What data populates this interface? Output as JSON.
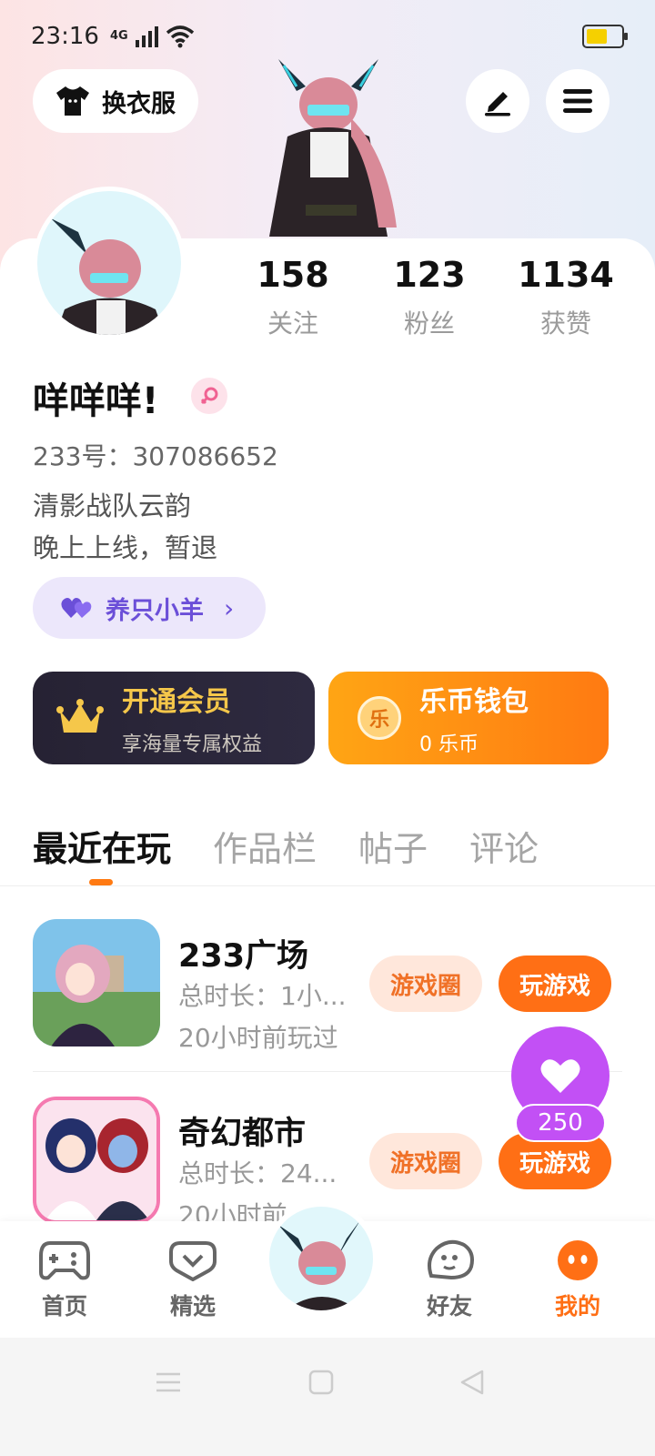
{
  "status_bar": {
    "time": "23:16",
    "network": "4G"
  },
  "header": {
    "dress_button_label": "换衣服"
  },
  "profile": {
    "stats": [
      {
        "value": "158",
        "label": "关注"
      },
      {
        "value": "123",
        "label": "粉丝"
      },
      {
        "value": "1134",
        "label": "获赞"
      }
    ],
    "username": "咩咩咩!",
    "uid": "233号：307086652",
    "bio_line1": "清影战队云韵",
    "bio_line2": "晚上上线，暂退",
    "sheep_pill_label": "养只小羊"
  },
  "cards": {
    "vip": {
      "title": "开通会员",
      "subtitle": "享海量专属权益"
    },
    "wallet": {
      "title": "乐币钱包",
      "subtitle": "0 乐币",
      "coin_glyph": "乐"
    }
  },
  "tabs": [
    "最近在玩",
    "作品栏",
    "帖子",
    "评论"
  ],
  "games": [
    {
      "name": "233广场",
      "duration": "总时长：1小...",
      "last_played": "20小时前玩过",
      "circle_label": "游戏圈",
      "play_label": "玩游戏"
    },
    {
      "name": "奇幻都市",
      "duration": "总时长：24...",
      "last_played": "20小时前",
      "circle_label": "游戏圈",
      "play_label": "玩游戏"
    }
  ],
  "floating_like": {
    "count": "250"
  },
  "bottom_nav": [
    {
      "label": "首页",
      "icon": "gamepad-icon"
    },
    {
      "label": "精选",
      "icon": "heart-bubble-icon"
    },
    {
      "label": "好友",
      "icon": "friend-face-icon"
    },
    {
      "label": "我的",
      "icon": "me-face-icon"
    }
  ],
  "colors": {
    "accent": "#ff6f15",
    "like_purple": "#c250f5",
    "vip_gold": "#f5c74a"
  }
}
